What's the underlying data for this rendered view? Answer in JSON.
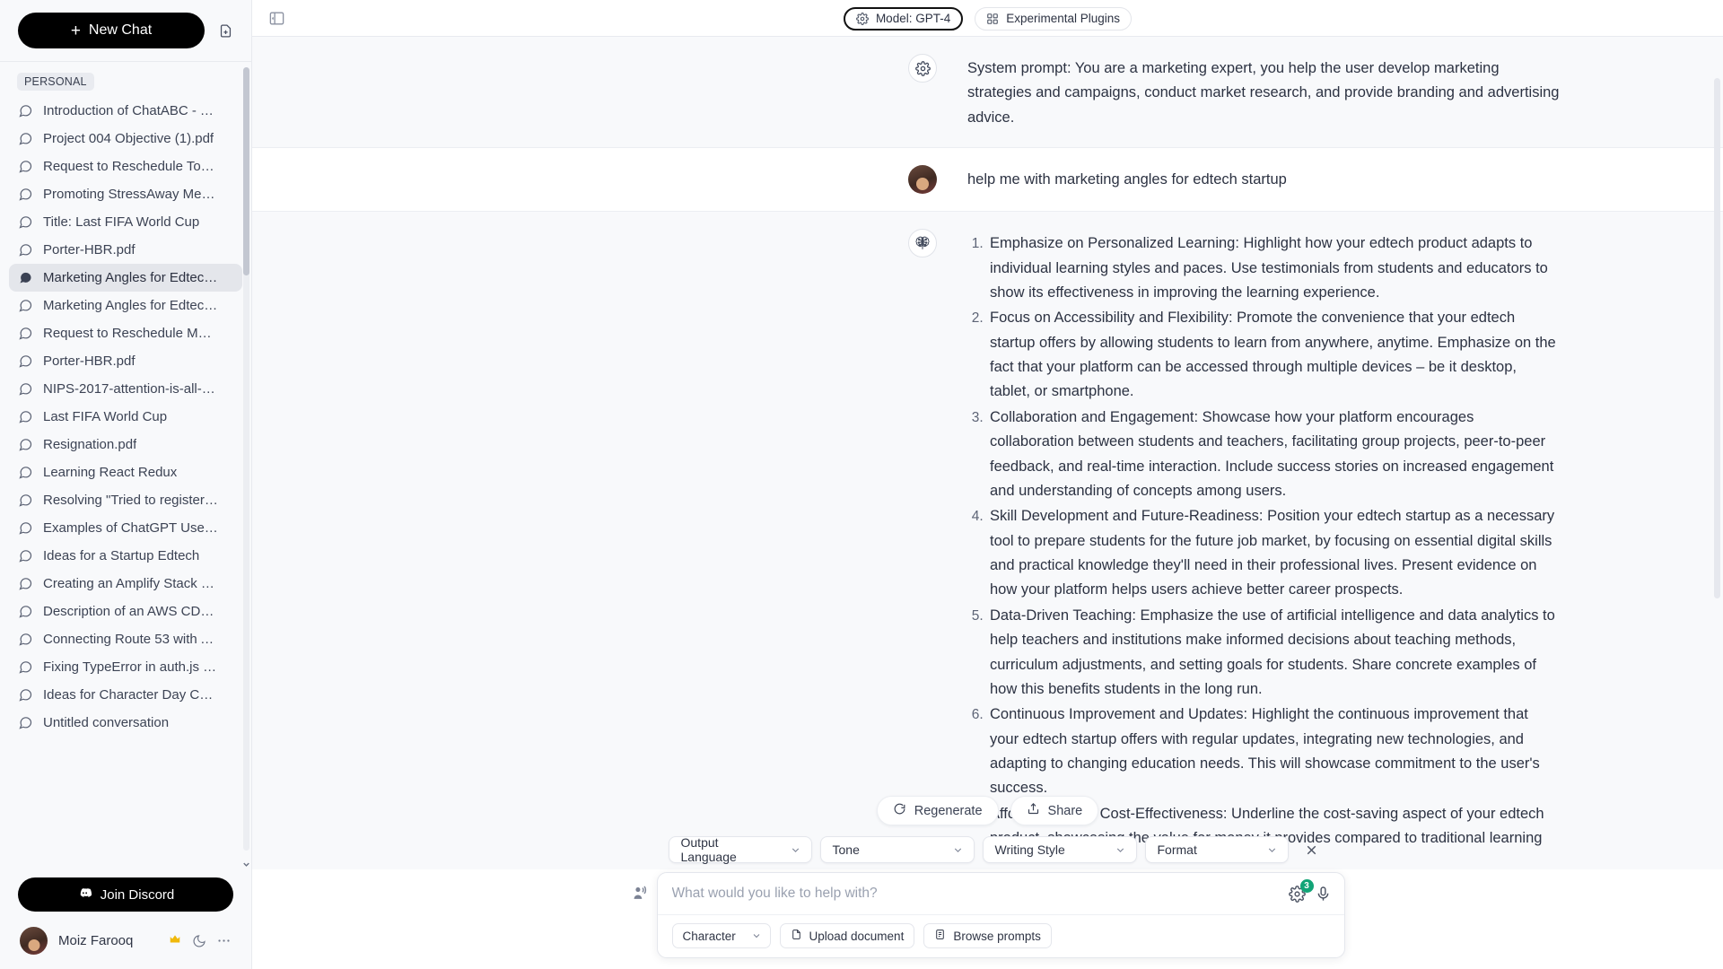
{
  "sidebar": {
    "new_chat_label": "New Chat",
    "new_doc_icon": "new-document-icon",
    "group_label": "PERSONAL",
    "items": [
      {
        "label": "Introduction of ChatABC - Th...",
        "active": false
      },
      {
        "label": "Project 004 Objective (1).pdf",
        "active": false
      },
      {
        "label": "Request to Reschedule Tomo...",
        "active": false
      },
      {
        "label": "Promoting StressAway Medit...",
        "active": false
      },
      {
        "label": "Title: Last FIFA World Cup",
        "active": false
      },
      {
        "label": "Porter-HBR.pdf",
        "active": false
      },
      {
        "label": "Marketing Angles for Edtech ...",
        "active": true
      },
      {
        "label": "Marketing Angles for Edtech ...",
        "active": false
      },
      {
        "label": "Request to Reschedule Meeti...",
        "active": false
      },
      {
        "label": "Porter-HBR.pdf",
        "active": false
      },
      {
        "label": "NIPS-2017-attention-is-all-yo...",
        "active": false
      },
      {
        "label": "Last FIFA World Cup",
        "active": false
      },
      {
        "label": "Resignation.pdf",
        "active": false
      },
      {
        "label": "Learning React Redux",
        "active": false
      },
      {
        "label": "Resolving \"Tried to register t...",
        "active": false
      },
      {
        "label": "Examples of ChatGPT Use Ca...",
        "active": false
      },
      {
        "label": "Ideas for a Startup Edtech",
        "active": false
      },
      {
        "label": "Creating an Amplify Stack us...",
        "active": false
      },
      {
        "label": "Description of an AWS CDK c...",
        "active": false
      },
      {
        "label": "Connecting Route 53 with A...",
        "active": false
      },
      {
        "label": "Fixing TypeError in auth.js mi...",
        "active": false
      },
      {
        "label": "Ideas for Character Day Cost...",
        "active": false
      },
      {
        "label": "Untitled conversation",
        "active": false
      }
    ],
    "discord_label": "Join Discord",
    "user_name": "Moiz Farooq",
    "user_badges": [
      "crown-icon",
      "moon-icon",
      "more-options-icon"
    ]
  },
  "topbar": {
    "collapse_icon": "collapse-sidebar-icon",
    "model_label": "Model: GPT-4",
    "plugins_label": "Experimental Plugins"
  },
  "conversation": {
    "system_message": "System prompt: You are a marketing expert, you help the user develop marketing strategies and campaigns, conduct market research, and provide branding and advertising advice.",
    "user_message": "help me with marketing angles for edtech startup",
    "assistant_items": [
      "Emphasize on Personalized Learning: Highlight how your edtech product adapts to individual learning styles and paces. Use testimonials from students and educators to show its effectiveness in improving the learning experience.",
      "Focus on Accessibility and Flexibility: Promote the convenience that your edtech startup offers by allowing students to learn from anywhere, anytime. Emphasize on the fact that your platform can be accessed through multiple devices – be it desktop, tablet, or smartphone.",
      "Collaboration and Engagement: Showcase how your platform encourages collaboration between students and teachers, facilitating group projects, peer-to-peer feedback, and real-time interaction. Include success stories on increased engagement and understanding of concepts among users.",
      "Skill Development and Future-Readiness: Position your edtech startup as a necessary tool to prepare students for the future job market, by focusing on essential digital skills and practical knowledge they'll need in their professional lives. Present evidence on how your platform helps users achieve better career prospects.",
      "Data-Driven Teaching: Emphasize the use of artificial intelligence and data analytics to help teachers and institutions make informed decisions about teaching methods, curriculum adjustments, and setting goals for students. Share concrete examples of how this benefits students in the long run.",
      "Continuous Improvement and Updates: Highlight the continuous improvement that your edtech startup offers with regular updates, integrating new technologies, and adapting to changing education needs. This will showcase commitment to the user's success.",
      "Affordability and Cost-Effectiveness: Underline the cost-saving aspect of your edtech product, showcasing the value for money it provides compared to traditional learning"
    ]
  },
  "actions": {
    "regenerate_label": "Regenerate",
    "share_label": "Share"
  },
  "options_bar": {
    "output_language": "Output Language",
    "tone": "Tone",
    "writing_style": "Writing Style",
    "format": "Format",
    "close_icon": "close-icon"
  },
  "composer": {
    "placeholder": "What would you like to help with?",
    "value": "",
    "badge_count": "3",
    "character_label": "Character",
    "upload_label": "Upload document",
    "browse_label": "Browse prompts"
  },
  "colors": {
    "accent_green": "#12a477",
    "sidebar_bg": "#f8f9fb",
    "active_item": "#e4e6eb",
    "text": "#2c3242"
  }
}
